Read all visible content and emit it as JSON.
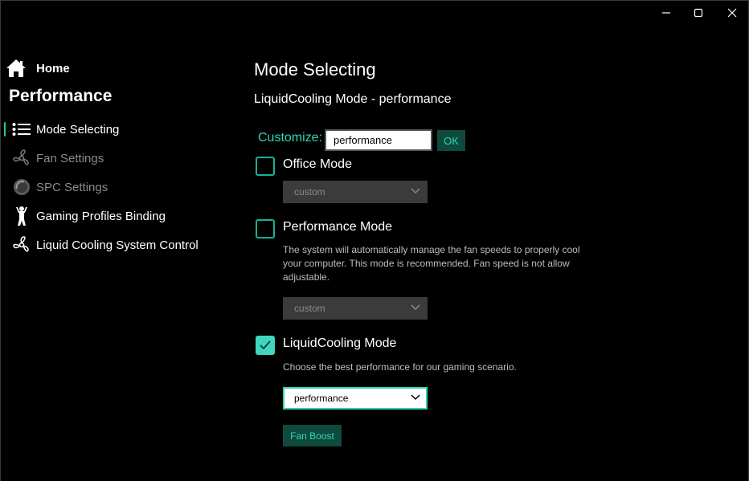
{
  "titlebar": {
    "minimize_icon": "minimize-icon",
    "maximize_icon": "maximize-icon",
    "close_icon": "close-icon"
  },
  "sidebar": {
    "home_label": "Home",
    "section_title": "Performance",
    "items": [
      {
        "label": "Mode Selecting",
        "icon": "list-icon",
        "selected": true
      },
      {
        "label": "Fan Settings",
        "icon": "fan-icon",
        "dim": true
      },
      {
        "label": "SPC Settings",
        "icon": "spc-icon",
        "dim": true
      },
      {
        "label": "Gaming Profiles Binding",
        "icon": "gamer-icon"
      },
      {
        "label": "Liquid Cooling System Control",
        "icon": "liquid-fan-icon"
      }
    ]
  },
  "main": {
    "title": "Mode Selecting",
    "subtitle": "LiquidCooling Mode - performance",
    "customize": {
      "label": "Customize:",
      "value": "performance",
      "ok_label": "OK"
    },
    "modes": [
      {
        "label": "Office Mode",
        "checked": false,
        "description": "",
        "dropdown_value": "custom"
      },
      {
        "label": "Performance Mode",
        "checked": false,
        "description": "The system will automatically manage the fan speeds to properly cool your computer.  This mode is recommended. Fan speed is not allow adjustable.",
        "dropdown_value": "custom"
      },
      {
        "label": "LiquidCooling Mode",
        "checked": true,
        "description": "Choose the best performance for our gaming scenario.",
        "dropdown_value": "performance"
      }
    ],
    "fan_boost_label": "Fan Boost"
  },
  "colors": {
    "accent": "#2fd6b4",
    "accent_dark": "#0f4a3e",
    "background": "#000000"
  }
}
